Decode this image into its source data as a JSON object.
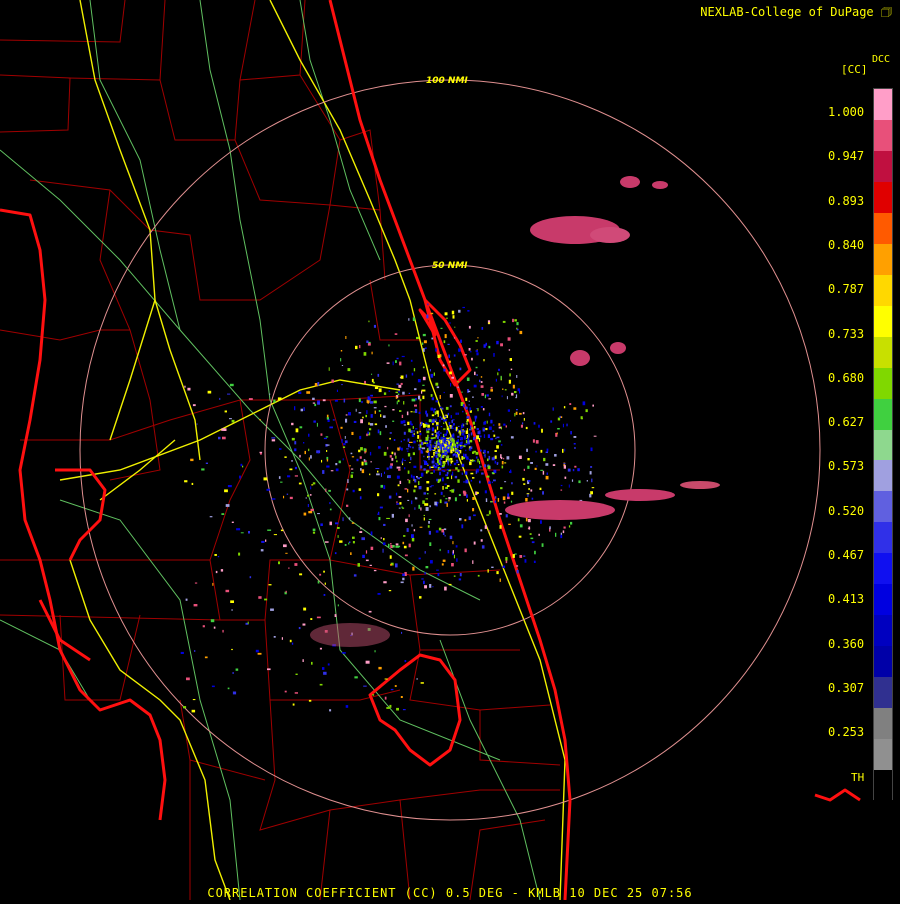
{
  "header": {
    "credit": "NEXLAB-College of DuPage"
  },
  "legend": {
    "product_code": "DCC",
    "unit": "[CC]",
    "values": [
      "1.000",
      "0.947",
      "0.893",
      "0.840",
      "0.787",
      "0.733",
      "0.680",
      "0.627",
      "0.573",
      "0.520",
      "0.467",
      "0.413",
      "0.360",
      "0.307",
      "0.253"
    ],
    "threshold_label": "TH",
    "colors": [
      "#ff9ec8",
      "#e8507a",
      "#c01040",
      "#e00000",
      "#ff5a00",
      "#ffa000",
      "#ffd800",
      "#ffff00",
      "#c8e000",
      "#80d800",
      "#40d040",
      "#8ed88e",
      "#a0a0e0",
      "#6060e0",
      "#3030e8",
      "#1010f0",
      "#0000e0",
      "#0000c0",
      "#0000a8",
      "#303090",
      "#808080",
      "#909090",
      "#000000"
    ]
  },
  "range_rings": {
    "outer_label": "100 NMI",
    "inner_label": "50 NMI"
  },
  "footer": {
    "caption": "CORRELATION COEFFICIENT (CC) 0.5 DEG - KMLB 10 DEC 25 07:56"
  },
  "icons": {
    "credit_badge": "corner-logo-icon"
  }
}
